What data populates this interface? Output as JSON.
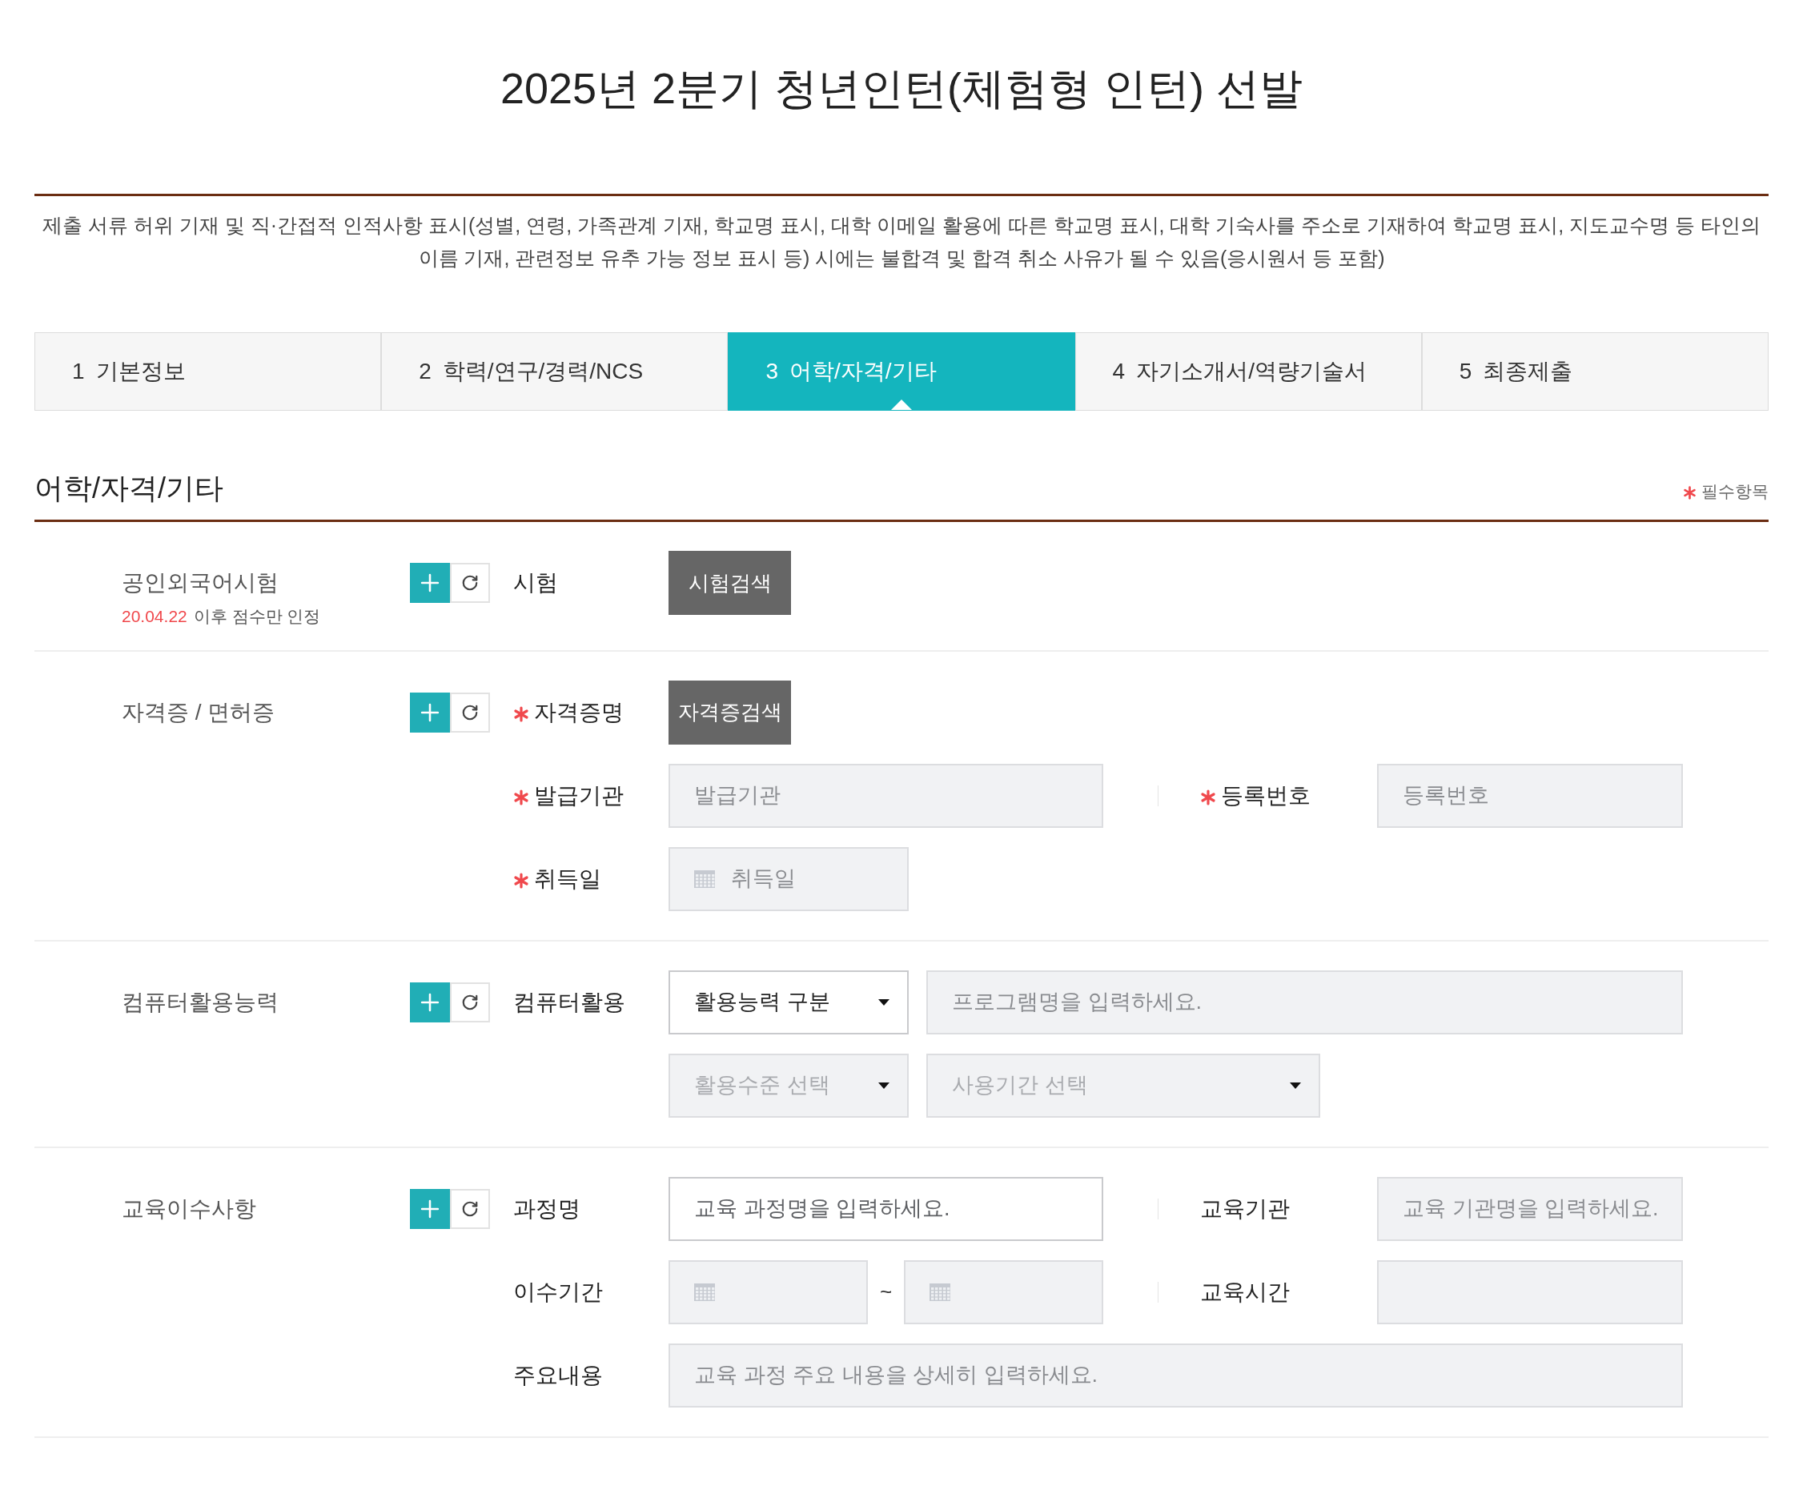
{
  "page_title": "2025년 2분기 청년인턴(체험형 인턴) 선발",
  "notice": "제출 서류 허위 기재 및 직·간접적 인적사항 표시(성별, 연령, 가족관계 기재, 학교명 표시, 대학 이메일 활용에 따른 학교명 표시, 대학 기숙사를 주소로 기재하여 학교명 표시, 지도교수명 등 타인의 이름 기재, 관련정보 유추 가능 정보 표시 등) 시에는 불합격 및 합격 취소 사유가 될 수 있음(응시원서 등 포함)",
  "steps": [
    {
      "number": "1",
      "label": "기본정보",
      "selected": false
    },
    {
      "number": "2",
      "label": "학력/연구/경력/NCS",
      "selected": false
    },
    {
      "number": "3",
      "label": "어학/자격/기타",
      "selected": true
    },
    {
      "number": "4",
      "label": "자기소개서/역량기술서",
      "selected": false
    },
    {
      "number": "5",
      "label": "최종제출",
      "selected": false
    }
  ],
  "section_title": "어학/자격/기타",
  "required_legend": "필수항목",
  "groups": [
    {
      "title": "공인외국어시험",
      "note_date": "20.04.22",
      "note_text": "이후 점수만 인정",
      "rows": [
        {
          "label": "시험",
          "required": false,
          "controls": [
            {
              "kind": "button",
              "text": "시험검색"
            }
          ]
        }
      ]
    },
    {
      "title": "자격증 / 면허증",
      "rows": [
        {
          "label": "자격증명",
          "required": true,
          "controls": [
            {
              "kind": "button",
              "text": "자격증검색"
            }
          ]
        },
        {
          "label": "발급기관",
          "required": true,
          "controls": [
            {
              "kind": "input",
              "placeholder": "발급기관",
              "disabled": true
            }
          ],
          "side": {
            "label": "등록번호",
            "required": true,
            "controls": [
              {
                "kind": "input",
                "placeholder": "등록번호",
                "disabled": true
              }
            ]
          }
        },
        {
          "label": "취득일",
          "required": true,
          "controls": [
            {
              "kind": "date",
              "placeholder": "취득일",
              "disabled": true
            }
          ]
        }
      ]
    },
    {
      "title": "컴퓨터활용능력",
      "rows": [
        {
          "label": "컴퓨터활용",
          "required": false,
          "controls": [
            {
              "kind": "select",
              "value": "활용능력 구분",
              "disabled": false
            },
            {
              "kind": "input",
              "placeholder": "프로그램명을 입력하세요.",
              "disabled": true
            }
          ]
        },
        {
          "controls": [
            {
              "kind": "select",
              "value": "활용수준 선택",
              "disabled": true
            },
            {
              "kind": "select",
              "value": "사용기간 선택",
              "disabled": true
            }
          ]
        }
      ]
    },
    {
      "title": "교육이수사항",
      "rows": [
        {
          "label": "과정명",
          "required": false,
          "controls": [
            {
              "kind": "input",
              "placeholder": "교육 과정명을 입력하세요.",
              "disabled": false
            }
          ],
          "side": {
            "label": "교육기관",
            "required": false,
            "controls": [
              {
                "kind": "input",
                "placeholder": "교육 기관명을 입력하세요.",
                "disabled": true
              }
            ]
          }
        },
        {
          "label": "이수기간",
          "required": false,
          "controls": [
            {
              "kind": "date",
              "disabled": true
            },
            {
              "kind": "separator",
              "text": "~"
            },
            {
              "kind": "date",
              "disabled": true
            }
          ],
          "side": {
            "label": "교육시간",
            "required": false,
            "controls": [
              {
                "kind": "input",
                "disabled": true
              }
            ]
          }
        },
        {
          "label": "주요내용",
          "required": false,
          "controls": [
            {
              "kind": "input",
              "placeholder": "교육 과정 주요 내용을 상세히 입력하세요.",
              "disabled": true
            }
          ]
        }
      ]
    }
  ]
}
